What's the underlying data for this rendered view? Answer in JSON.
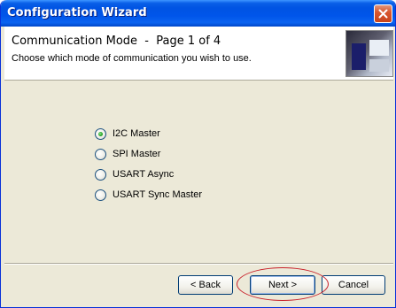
{
  "window": {
    "title": "Configuration Wizard",
    "close_icon": "close-icon"
  },
  "header": {
    "title": "Communication Mode  -  Page 1 of 4",
    "subtitle": "Choose which mode of communication you wish to use.",
    "image_icon": "wizard-banner-image"
  },
  "modes": {
    "selected": "I2C Master",
    "options": [
      "I2C Master",
      "SPI Master",
      "USART Async",
      "USART Sync Master"
    ]
  },
  "buttons": {
    "back": "< Back",
    "next": "Next >",
    "cancel": "Cancel"
  },
  "colors": {
    "titlebar": "#0054e3",
    "face": "#ece9d8",
    "highlight_ellipse": "#c8202a",
    "radio_selected": "#21a121"
  }
}
